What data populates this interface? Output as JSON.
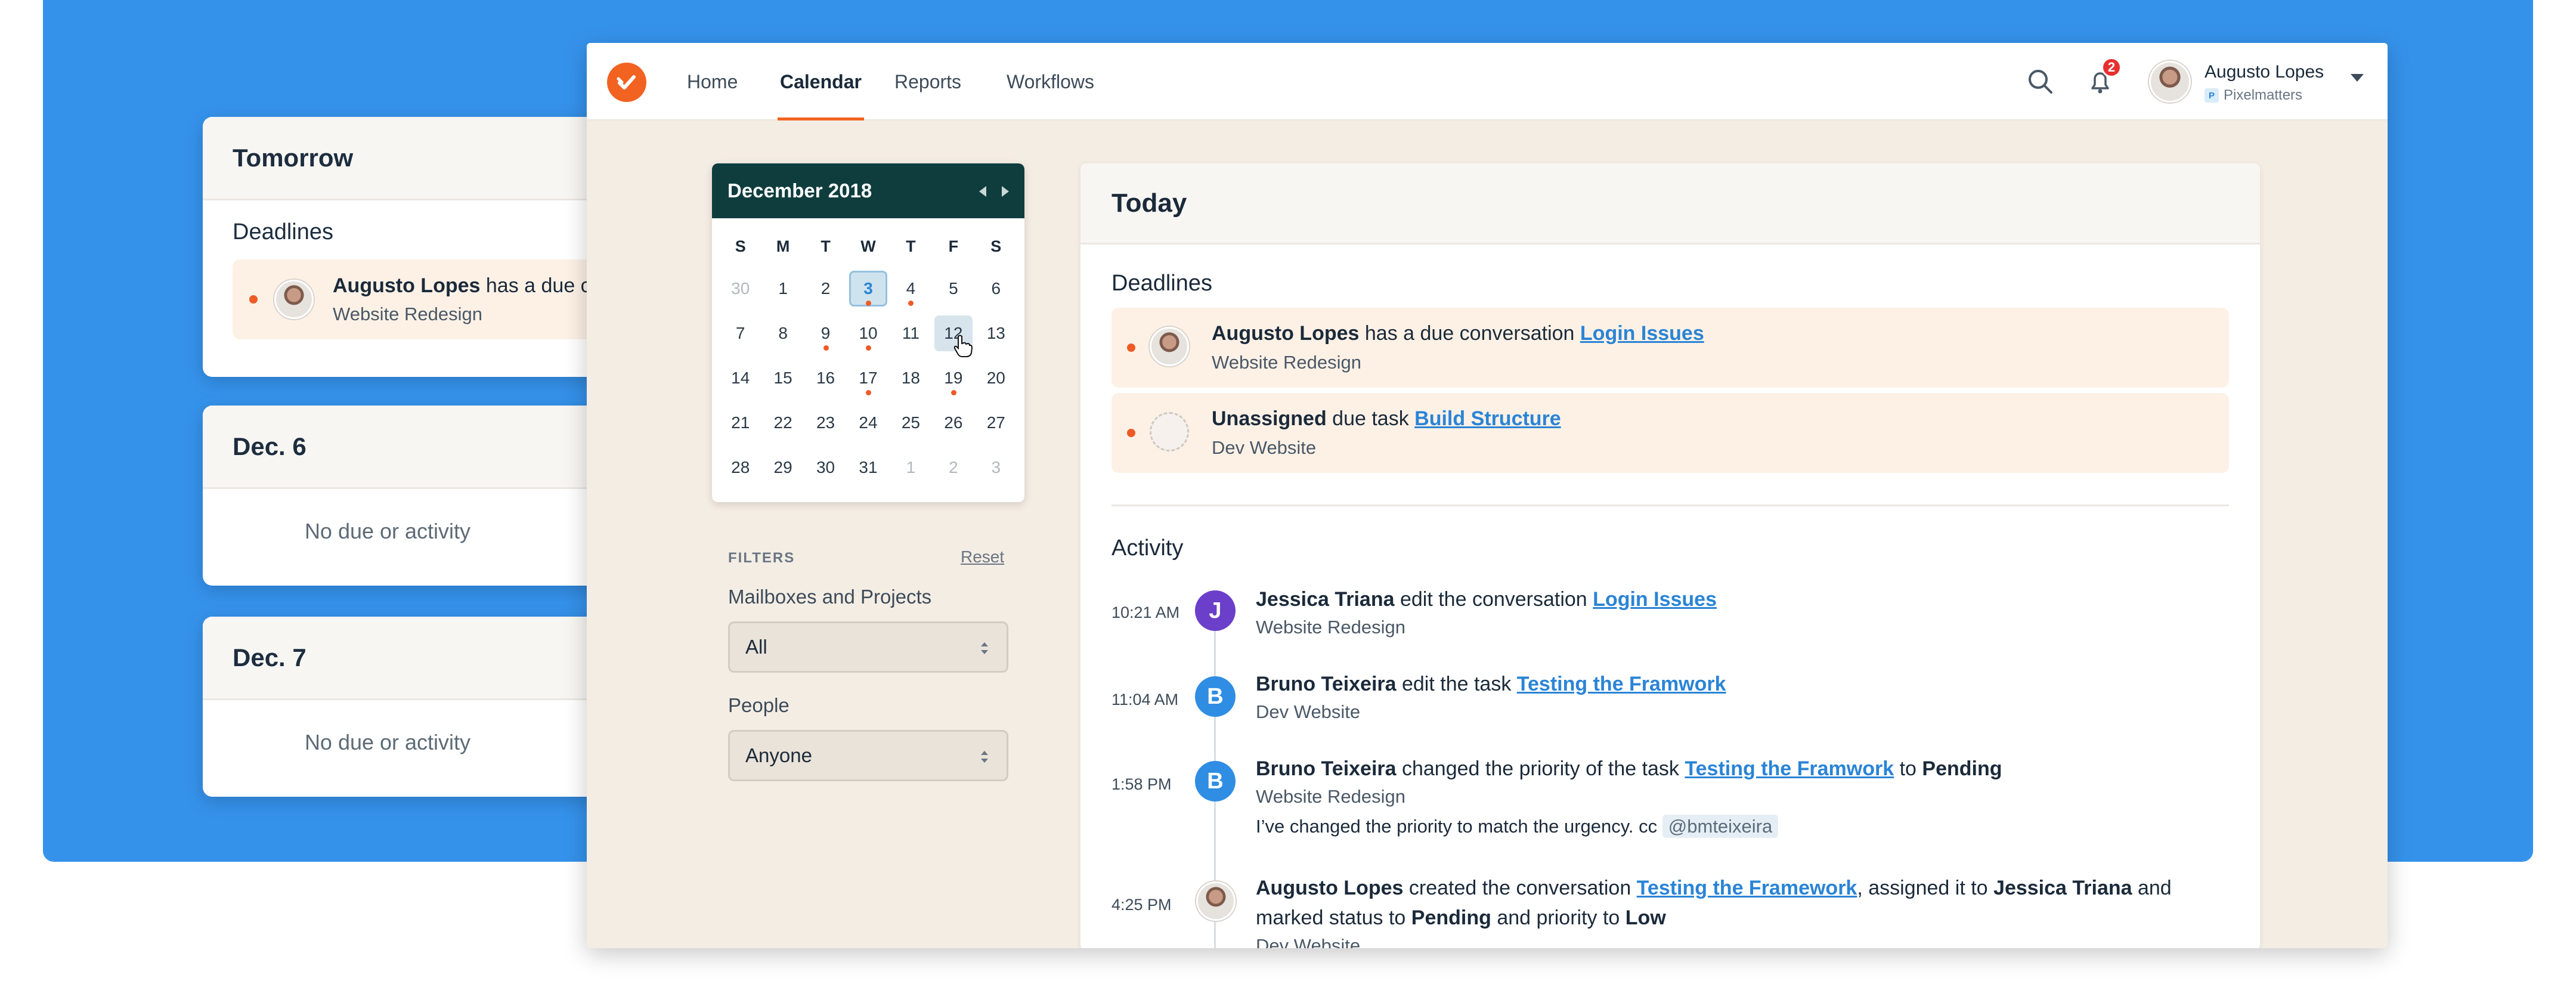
{
  "colors": {
    "background_blue": "#3592eb",
    "accent_orange": "#f26322",
    "calendar_header": "#0f3d3e",
    "link_blue": "#2a84d6",
    "avatar_purple": "#6b3fc9",
    "avatar_blue": "#2f8de4"
  },
  "bg_cards": {
    "tomorrow": {
      "title": "Tomorrow",
      "section": "Deadlines",
      "item_name": "Augusto Lopes",
      "item_text": " has a due c",
      "item_project": "Website Redesign"
    },
    "dec6": {
      "title": "Dec. 6",
      "empty": "No due or activity"
    },
    "dec7": {
      "title": "Dec. 7",
      "empty": "No due or activity"
    }
  },
  "nav": {
    "items": [
      "Home",
      "Calendar",
      "Reports",
      "Workflows"
    ],
    "active": "Calendar",
    "notification_count": "2",
    "user_name": "Augusto Lopes",
    "user_org": "Pixelmatters",
    "org_initial": "P"
  },
  "calendar": {
    "month_label": "December 2018",
    "weekdays": [
      "S",
      "M",
      "T",
      "W",
      "T",
      "F",
      "S"
    ],
    "weeks": [
      [
        "30",
        "1",
        "2",
        "3",
        "4",
        "5",
        "6"
      ],
      [
        "7",
        "8",
        "9",
        "10",
        "11",
        "12",
        "13"
      ],
      [
        "14",
        "15",
        "16",
        "17",
        "18",
        "19",
        "20"
      ],
      [
        "21",
        "22",
        "23",
        "24",
        "25",
        "26",
        "27"
      ],
      [
        "28",
        "29",
        "30",
        "31",
        "1",
        "2",
        "3"
      ]
    ],
    "muted_days": [
      [
        0,
        0
      ],
      [
        4,
        4
      ],
      [
        4,
        5
      ],
      [
        4,
        6
      ]
    ],
    "event_days": [
      [
        0,
        3
      ],
      [
        0,
        4
      ],
      [
        1,
        2
      ],
      [
        1,
        3
      ],
      [
        2,
        3
      ],
      [
        2,
        5
      ]
    ],
    "selected_day": "3",
    "hovered_day": "12"
  },
  "filters": {
    "label": "FILTERS",
    "reset": "Reset",
    "mailboxes_label": "Mailboxes and Projects",
    "mailboxes_value": "All",
    "people_label": "People",
    "people_value": "Anyone"
  },
  "today": {
    "title": "Today",
    "deadlines_title": "Deadlines",
    "deadlines": [
      {
        "who": "Augusto Lopes",
        "text": " has a due conversation ",
        "link": "Login Issues",
        "project": "Website Redesign"
      },
      {
        "who": "Unassigned",
        "text": " due task ",
        "link": "Build Structure",
        "project": "Dev Website"
      }
    ],
    "activity_title": "Activity",
    "activity": [
      {
        "time": "10:21 AM",
        "initial": "J",
        "who": "Jessica Triana",
        "text": " edit the conversation ",
        "link": "Login Issues",
        "project": "Website Redesign"
      },
      {
        "time": "11:04 AM",
        "initial": "B",
        "who": "Bruno Teixeira",
        "text": " edit the task ",
        "link": "Testing the Framwork",
        "project": "Dev Website"
      },
      {
        "time": "1:58 PM",
        "initial": "B",
        "who": "Bruno Teixeira",
        "text": " changed the priority of the task ",
        "link": "Testing the Framwork",
        "text2": " to ",
        "bold2": "Pending",
        "project": "Website Redesign",
        "comment": "I’ve changed the priority to match the urgency. cc ",
        "mention": "@bmteixeira"
      },
      {
        "time": "4:25 PM",
        "initial": "",
        "who": "Augusto Lopes",
        "text": " created the conversation ",
        "link": "Testing the Framework",
        "text2": ", assigned it to ",
        "bold2": "Jessica Triana",
        "text3": " and",
        "line2_a": "marked status to ",
        "line2_b": "Pending",
        "line2_c": " and priority to ",
        "line2_d": "Low",
        "project": "Dev Website"
      }
    ]
  }
}
